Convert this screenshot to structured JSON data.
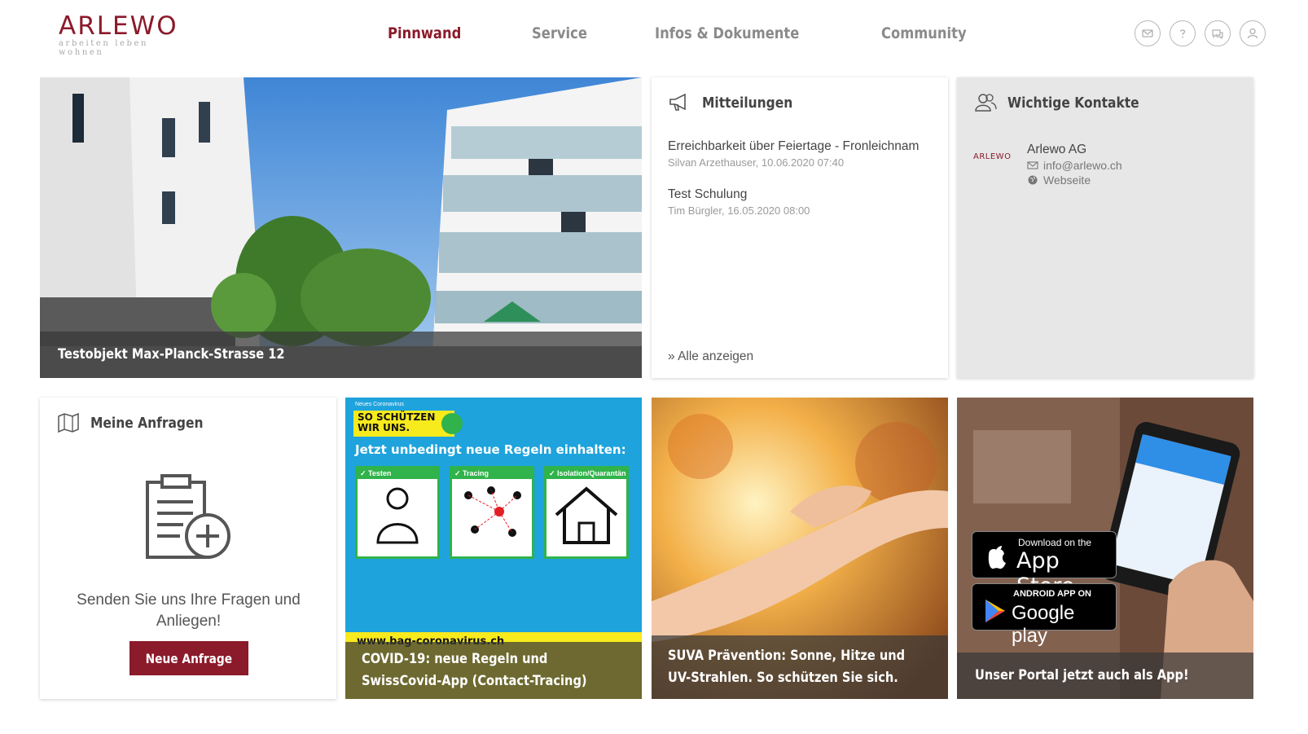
{
  "header": {
    "logo": {
      "word": "ARLEWO",
      "tagline": "arbeiten leben wohnen"
    },
    "nav": [
      {
        "label": "Pinnwand",
        "active": true
      },
      {
        "label": "Service",
        "active": false
      },
      {
        "label": "Infos & Dokumente",
        "active": false
      },
      {
        "label": "Community",
        "active": false
      }
    ],
    "icons": [
      "mail-icon",
      "help-icon",
      "chat-icon",
      "user-icon"
    ]
  },
  "hero": {
    "caption": "Testobjekt Max-Planck-Strasse 12"
  },
  "mitteilungen": {
    "title": "Mitteilungen",
    "items": [
      {
        "title": "Erreichbarkeit über Feiertage - Fronleichnam",
        "meta": "Silvan Arzethauser, 10.06.2020 07:40"
      },
      {
        "title": "Test Schulung",
        "meta": "Tim Bürgler, 16.05.2020 08:00"
      }
    ],
    "all_link": "» Alle anzeigen"
  },
  "kontakte": {
    "title": "Wichtige Kontakte",
    "logo_text": "ARLEWO",
    "name": "Arlewo AG",
    "email": "info@arlewo.ch",
    "website": "Webseite"
  },
  "anfragen": {
    "title": "Meine Anfragen",
    "text": "Senden Sie uns Ihre Fragen und Anliegen!",
    "button": "Neue Anfrage"
  },
  "covid": {
    "kicker": "Neues Coronavirus",
    "badge_line1": "SO SCHÜTZEN",
    "badge_line2": "WIR UNS.",
    "headline": "Jetzt unbedingt neue Regeln einhalten:",
    "panels": [
      "✓ Testen",
      "✓ Tracing",
      "✓ Isolation/Quarantäne"
    ],
    "url": "www.bag-coronavirus.ch",
    "caption": "COVID-19: neue Regeln und SwissCovid-App (Contact-Tracing)"
  },
  "suva": {
    "caption": "SUVA Prävention: Sonne, Hitze und UV-Strahlen. So schützen Sie sich."
  },
  "app": {
    "appstore_small": "Download on the",
    "appstore_big": "App Store",
    "gplay_small": "ANDROID APP ON",
    "gplay_big": "Google play",
    "caption": "Unser Portal jetzt auch als App!"
  },
  "colors": {
    "brand": "#8b1a2b",
    "nav_inactive": "#8a8a8a",
    "covid_blue": "#1ea3dc",
    "covid_yellow": "#f7ea1d",
    "covid_green": "#2fb34a"
  }
}
